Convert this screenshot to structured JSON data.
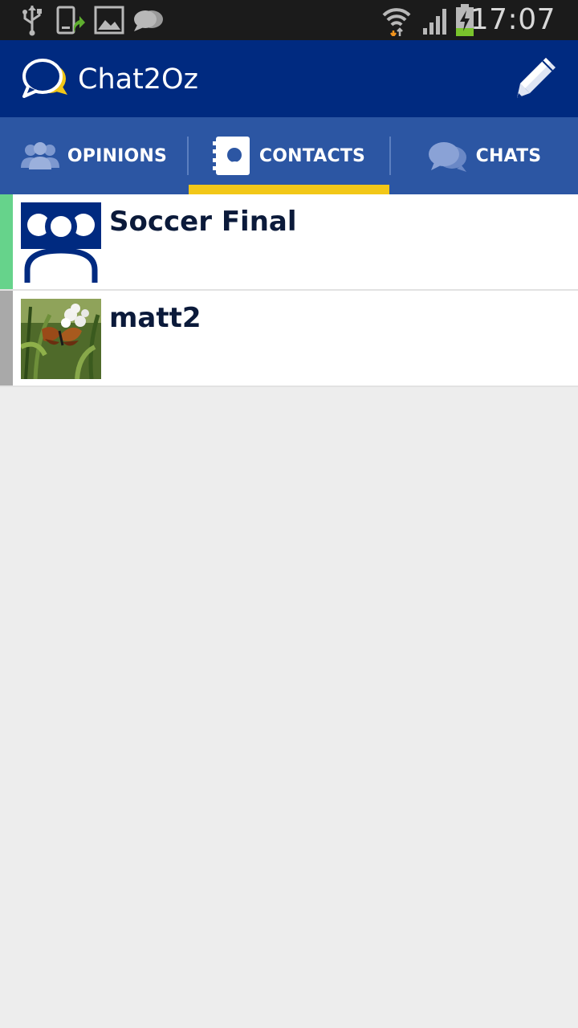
{
  "status_bar": {
    "time": "17:07",
    "icons": [
      "usb-icon",
      "screenshot-sync-icon",
      "gallery-icon",
      "chat-notification-icon",
      "wifi-icon",
      "signal-icon",
      "battery-charging-icon"
    ]
  },
  "app_bar": {
    "title": "Chat2Oz",
    "logo_icon": "chat-bubble-logo-icon",
    "action_icon": "pencil-icon"
  },
  "tabs": [
    {
      "label": "OPINIONS",
      "icon": "people-icon",
      "selected": false
    },
    {
      "label": "CONTACTS",
      "icon": "contacts-book-icon",
      "selected": true
    },
    {
      "label": "CHATS",
      "icon": "chat-bubbles-icon",
      "selected": false
    }
  ],
  "contacts": [
    {
      "name": "Soccer Final",
      "avatar": "group-avatar-icon",
      "status_color": "#66d38b"
    },
    {
      "name": "matt2",
      "avatar": "butterfly-photo",
      "status_color": "#a9a9a9"
    }
  ],
  "colors": {
    "status_bar": "#1b1b1b",
    "app_bar": "#002a80",
    "tab_bar": "#2c56a3",
    "tab_indicator": "#f2c718",
    "background": "#ededed"
  }
}
